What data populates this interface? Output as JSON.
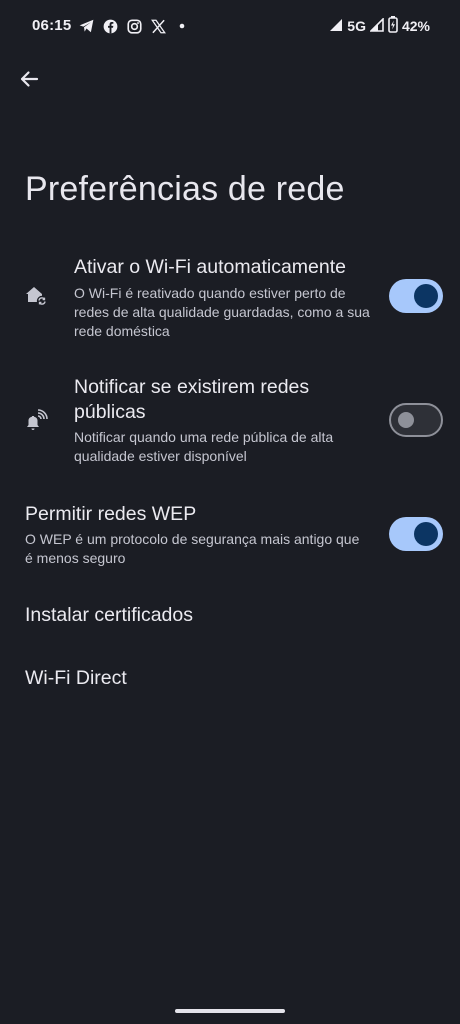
{
  "status_bar": {
    "time": "06:15",
    "notification_icons": [
      "telegram-icon",
      "facebook-icon",
      "instagram-icon",
      "x-icon",
      "dot-icon"
    ],
    "network": "5G",
    "battery": "42%"
  },
  "header": {
    "back_icon": "arrow-left-icon",
    "title": "Preferências de rede"
  },
  "settings": [
    {
      "icon": "home-wifi-icon",
      "title": "Ativar o Wi-Fi automaticamente",
      "summary": "O Wi-Fi é reativado quando estiver perto de redes de alta qualidade guardadas, como a sua rede doméstica",
      "toggle": true
    },
    {
      "icon": "notification-wifi-icon",
      "title": "Notificar se existirem redes públicas",
      "summary": "Notificar quando uma rede pública de alta qualidade estiver disponível",
      "toggle": false
    },
    {
      "title": "Permitir redes WEP",
      "summary": "O WEP é um protocolo de segurança mais antigo que é menos seguro",
      "toggle": true
    },
    {
      "title": "Instalar certificados"
    },
    {
      "title": "Wi-Fi Direct"
    }
  ],
  "colors": {
    "background": "#1b1d24",
    "toggle_on_track": "#a7c8fb",
    "toggle_on_knob": "#0c3563",
    "toggle_off_outline": "#8e9099"
  }
}
